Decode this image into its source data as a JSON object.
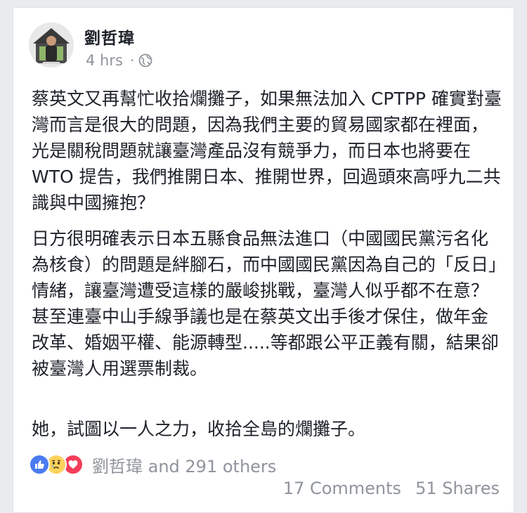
{
  "post": {
    "author": "劉哲瑋",
    "timestamp": "4 hrs",
    "separator": "·",
    "privacy_icon": "globe-icon",
    "paragraphs": [
      "蔡英文又再幫忙收拾爛攤子，如果無法加入 CPTPP 確實對臺灣而言是很大的問題，因為我們主要的貿易國家都在裡面，光是關稅問題就讓臺灣產品沒有競爭力，而日本也將要在 WTO 提告，我們推開日本、推開世界，回過頭來高呼九二共識與中國擁抱？",
      "日方很明確表示日本五縣食品無法進口（中國國民黨污名化為核食）的問題是絆腳石，而中國國民黨因為自己的「反日」情緒，讓臺灣遭受這樣的嚴峻挑戰，臺灣人似乎都不在意？甚至連臺中山手線爭議也是在蔡英文出手後才保住，做年金改革、婚姻平權、能源轉型.....等都跟公平正義有關，結果卻被臺灣人用選票制裁。",
      "她，試圖以一人之力，收拾全島的爛攤子。"
    ]
  },
  "reactions": {
    "icons": [
      "like-icon",
      "sad-icon",
      "love-icon"
    ],
    "summary": "劉哲瑋 and 291 others"
  },
  "footer": {
    "comments": "17 Comments",
    "shares": "51 Shares"
  },
  "colors": {
    "like": "#4a7bf0",
    "sad": "#fcd35c",
    "love": "#f33e58",
    "meta_text": "#90949c",
    "body_text": "#1d2129"
  }
}
